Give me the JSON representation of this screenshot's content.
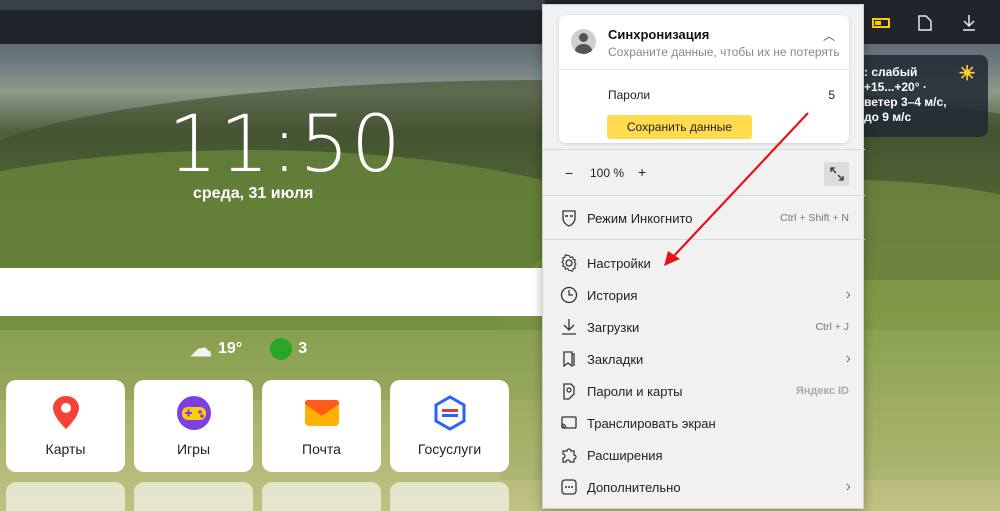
{
  "home": {
    "time": "11:50",
    "date": "среда, 31 июля",
    "weather_temp": "19°",
    "traffic_score": "3",
    "weather_card": {
      "line1": ": слабый",
      "line2": "+15...+20° ·",
      "line3": "ветер 3–4 м/с,",
      "line4": "до 9 м/с"
    },
    "tiles": [
      {
        "label": "Карты",
        "icon": "map-pin-icon",
        "color": "#f44336"
      },
      {
        "label": "Игры",
        "icon": "gamepad-icon",
        "color": "#7b3fe4"
      },
      {
        "label": "Почта",
        "icon": "mail-icon",
        "color": "#ff7a1a"
      },
      {
        "label": "Госуслуги",
        "icon": "gosuslugi-icon",
        "color": "#2962ff"
      }
    ]
  },
  "menu": {
    "sync": {
      "title": "Синхронизация",
      "subtitle": "Сохраните данные, чтобы их не потерять",
      "passwords_label": "Пароли",
      "passwords_count": "5",
      "save_button": "Сохранить данные"
    },
    "zoom": {
      "minus": "−",
      "value": "100 %",
      "plus": "+"
    },
    "items": [
      {
        "label": "Режим Инкогнито",
        "hint": "Ctrl + Shift + N"
      },
      {
        "label": "Настройки",
        "hint": ""
      },
      {
        "label": "История",
        "hint": ""
      },
      {
        "label": "Загрузки",
        "hint": "Ctrl + J"
      },
      {
        "label": "Закладки",
        "hint": ""
      },
      {
        "label": "Пароли и карты",
        "hint": "Яндекс ID"
      },
      {
        "label": "Транслировать экран",
        "hint": ""
      },
      {
        "label": "Расширения",
        "hint": ""
      },
      {
        "label": "Дополнительно",
        "hint": ""
      }
    ]
  },
  "colors": {
    "accent_yellow": "#ffdb4d",
    "annotation_arrow": "#e8121a"
  }
}
